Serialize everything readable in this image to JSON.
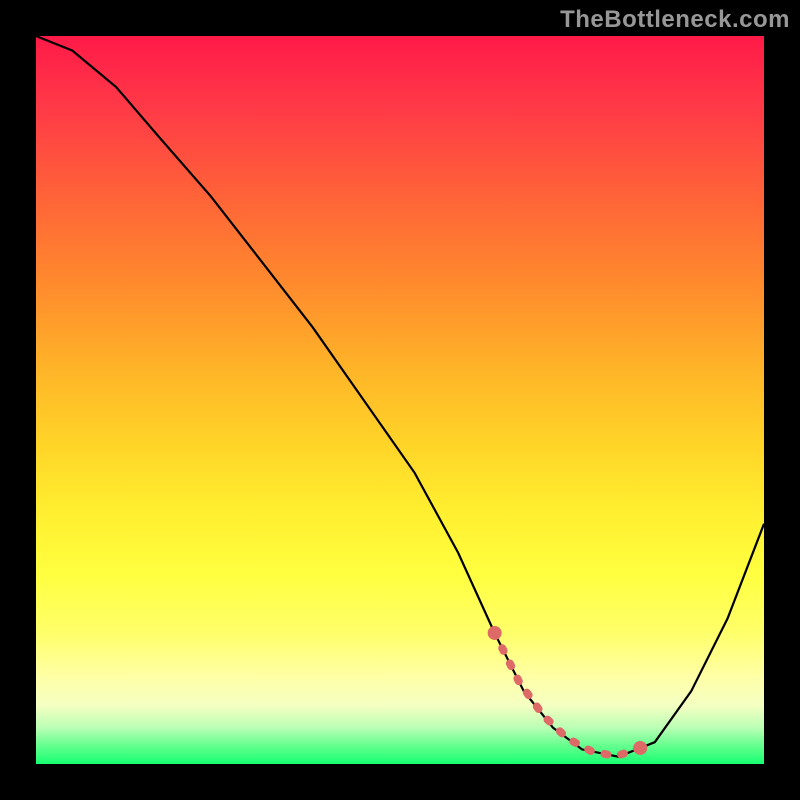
{
  "watermark": "TheBottleneck.com",
  "chart_data": {
    "type": "line",
    "title": "",
    "xlabel": "",
    "ylabel": "",
    "xlim": [
      0,
      100
    ],
    "ylim": [
      0,
      100
    ],
    "grid": false,
    "x": [
      0,
      5,
      11,
      17,
      24,
      31,
      38,
      45,
      52,
      58,
      63,
      67,
      71,
      75,
      80,
      85,
      90,
      95,
      100
    ],
    "values": [
      100,
      98,
      93,
      86,
      78,
      69,
      60,
      50,
      40,
      29,
      18,
      10,
      5,
      2,
      1,
      3,
      10,
      20,
      33
    ],
    "flat_region_x": [
      63,
      83
    ],
    "legend": "none",
    "gradient": {
      "top_color": "#ff1a48",
      "bottom_color": "#17ff71",
      "meaning": "bottleneck-severity (red high → green low)"
    }
  }
}
